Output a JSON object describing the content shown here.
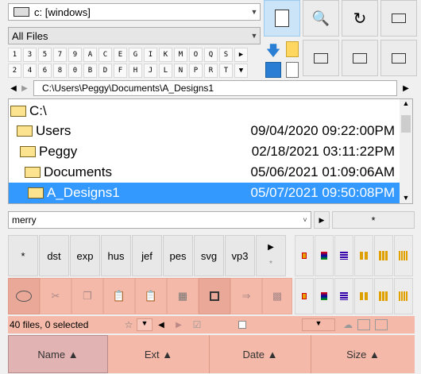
{
  "drive_combo": {
    "value": "c: [windows]"
  },
  "filter_combo": {
    "value": "All Files"
  },
  "letters_row1": [
    "1",
    "3",
    "5",
    "7",
    "9",
    "A",
    "C",
    "E",
    "G",
    "I",
    "K",
    "M",
    "O",
    "Q",
    "S"
  ],
  "letters_row2": [
    "2",
    "4",
    "6",
    "8",
    "0",
    "B",
    "D",
    "F",
    "H",
    "J",
    "L",
    "N",
    "P",
    "R",
    "T"
  ],
  "path": {
    "value": "C:\\Users\\Peggy\\Documents\\A_Designs1"
  },
  "tree": [
    {
      "name": "C:\\",
      "date": ""
    },
    {
      "name": "Users",
      "date": "09/04/2020 09:22:00PM"
    },
    {
      "name": "Peggy",
      "date": "02/18/2021 03:11:22PM"
    },
    {
      "name": "Documents",
      "date": "05/06/2021 01:09:06AM"
    },
    {
      "name": "A_Designs1",
      "date": "05/07/2021 09:50:08PM"
    }
  ],
  "search_combo": {
    "value": "merry"
  },
  "star_button": {
    "label": "*"
  },
  "filetypes": [
    "*",
    "dst",
    "exp",
    "hus",
    "jef",
    "pes",
    "svg",
    "vp3"
  ],
  "status": {
    "text": "40 files, 0 selected"
  },
  "columns": [
    {
      "label": "Name ▲"
    },
    {
      "label": "Ext ▲"
    },
    {
      "label": "Date ▲"
    },
    {
      "label": "Size ▲"
    }
  ],
  "colors": {
    "accent": "#3399ff",
    "salmon": "#f4b9a8",
    "selected_tool": "#cce4f7"
  }
}
